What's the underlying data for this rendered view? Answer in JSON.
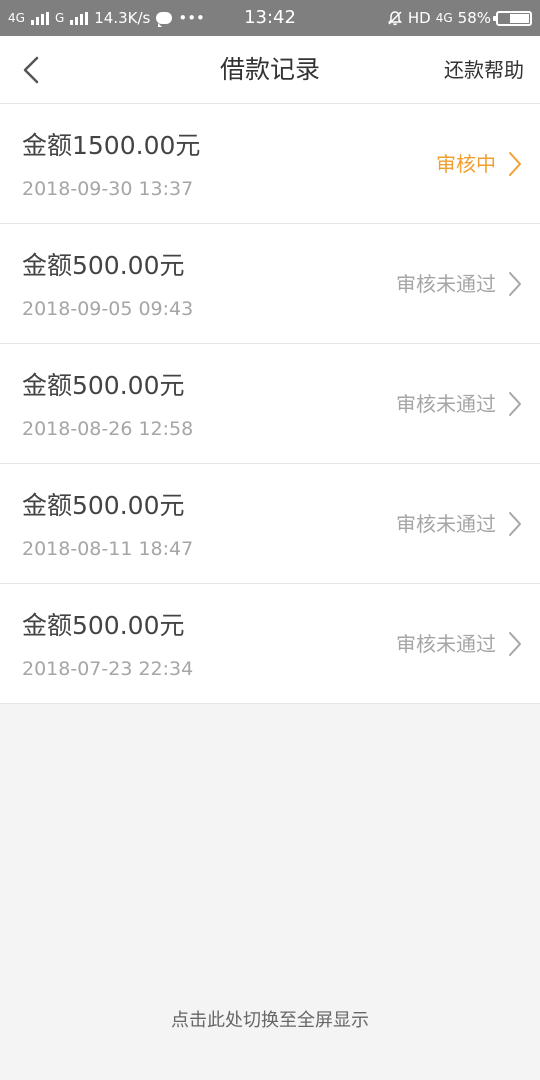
{
  "status_bar": {
    "network1": "4G",
    "network2": "G",
    "speed": "14.3K/s",
    "more": "•••",
    "time": "13:42",
    "hd": "HD",
    "network3": "4G",
    "battery_percent": "58%",
    "battery_level": 0.58
  },
  "nav": {
    "title": "借款记录",
    "help_label": "还款帮助"
  },
  "colors": {
    "pending": "#f0a030",
    "rejected": "#a6a6a6",
    "status_bar_bg": "#7f7f7f"
  },
  "records": [
    {
      "amount": "金额1500.00元",
      "date": "2018-09-30 13:37",
      "status": "审核中",
      "state": "pending"
    },
    {
      "amount": "金额500.00元",
      "date": "2018-09-05 09:43",
      "status": "审核未通过",
      "state": "rejected"
    },
    {
      "amount": "金额500.00元",
      "date": "2018-08-26 12:58",
      "status": "审核未通过",
      "state": "rejected"
    },
    {
      "amount": "金额500.00元",
      "date": "2018-08-11 18:47",
      "status": "审核未通过",
      "state": "rejected"
    },
    {
      "amount": "金额500.00元",
      "date": "2018-07-23 22:34",
      "status": "审核未通过",
      "state": "rejected"
    }
  ],
  "footer": {
    "fullscreen_hint": "点击此处切换至全屏显示"
  }
}
